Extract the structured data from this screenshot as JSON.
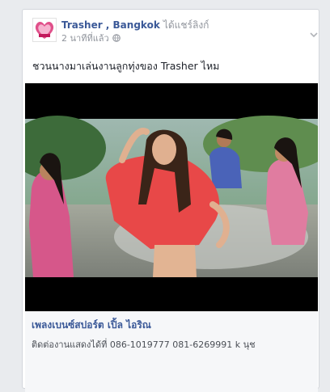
{
  "post": {
    "author": "Trasher , Bangkok",
    "action": "ได้แชร์ลิงก์",
    "timestamp": "2 นาทีที่แล้ว",
    "privacy_icon": "globe-icon",
    "menu_icon": "chevron-down-icon",
    "text": "ชวนนางมาเล่นงานลูกทุ่งของ Trasher ไหม"
  },
  "link": {
    "title": "เพลงเบนซ์สปอร์ต เปิ้ล ไอริณ",
    "description": "ติดต่องานแสดงได้ที่ 086-1019777 081-6269991 k นุช"
  },
  "colors": {
    "author": "#3b5998",
    "meta": "#90949c",
    "card_bg": "#ffffff",
    "page_bg": "#e9ebee",
    "link_bg": "#f6f7f9"
  }
}
